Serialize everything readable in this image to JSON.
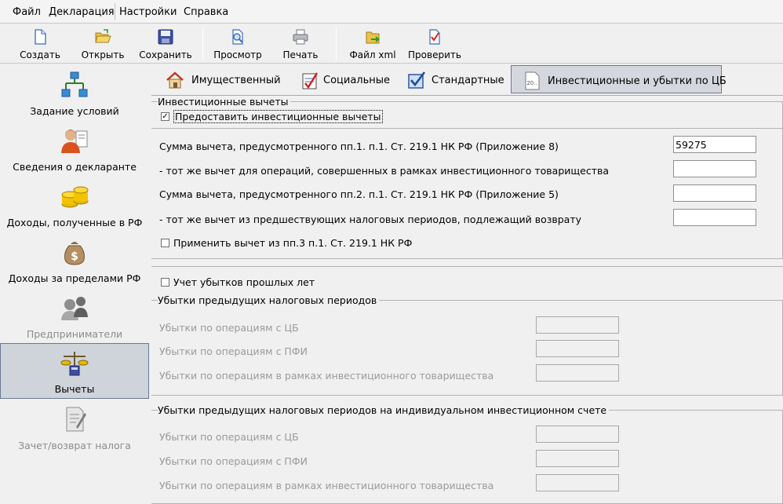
{
  "menu": {
    "items": [
      "Файл",
      "Декларация",
      "Настройки",
      "Справка"
    ]
  },
  "toolbar": {
    "create": "Создать",
    "open": "Открыть",
    "save": "Сохранить",
    "preview": "Просмотр",
    "print": "Печать",
    "xml": "Файл xml",
    "check": "Проверить"
  },
  "sidebar": {
    "items": [
      {
        "label": "Задание условий",
        "icon": "conditions-icon",
        "state": "normal"
      },
      {
        "label": "Сведения о декларанте",
        "icon": "declarant-icon",
        "state": "normal"
      },
      {
        "label": "Доходы, полученные в РФ",
        "icon": "coins-icon",
        "state": "normal"
      },
      {
        "label": "Доходы за пределами РФ",
        "icon": "money-bag-icon",
        "state": "normal"
      },
      {
        "label": "Предприниматели",
        "icon": "entrepreneurs-icon",
        "state": "disabled"
      },
      {
        "label": "Вычеты",
        "icon": "deductions-icon",
        "state": "active"
      },
      {
        "label": "Зачет/возврат налога",
        "icon": "refund-icon",
        "state": "disabled"
      }
    ]
  },
  "tabs": [
    {
      "label": "Имущественный",
      "icon": "house-icon"
    },
    {
      "label": "Социальные",
      "icon": "checklist-icon"
    },
    {
      "label": "Стандартные",
      "icon": "standard-check-icon"
    },
    {
      "label": "Инвестиционные и убытки по ЦБ",
      "icon": "document-icon",
      "active": true
    }
  ],
  "investment": {
    "legend": "Инвестиционные вычеты",
    "provide_label": "Предоставить инвестиционные вычеты",
    "provide_checked": true,
    "rows": [
      {
        "label": "Сумма вычета, предусмотренного пп.1. п.1. Ст. 219.1 НК РФ (Приложение 8)",
        "value": "59275"
      },
      {
        "label": "- тот же вычет для операций, совершенных в рамках инвестиционного товарищества",
        "value": ""
      },
      {
        "label": "Сумма вычета, предусмотренного пп.2. п.1. Ст. 219.1 НК РФ (Приложение 5)",
        "value": ""
      },
      {
        "label": "- тот же вычет из предшествующих налоговых периодов, подлежащий возврату",
        "value": ""
      }
    ],
    "apply_label": "Применить вычет из пп.3 п.1. Ст. 219.1 НК РФ",
    "apply_checked": false
  },
  "losses": {
    "account_label": "Учет убытков прошлых лет",
    "account_checked": false,
    "prev_legend": "Убытки предыдущих налоговых периодов",
    "prev_rows": [
      {
        "label": "Убытки по операциям с ЦБ",
        "value": ""
      },
      {
        "label": "Убытки по операциям с ПФИ",
        "value": ""
      },
      {
        "label": "Убытки по операциям в рамках инвестиционного товарищества",
        "value": ""
      }
    ],
    "iis_legend": "Убытки предыдущих налоговых периодов на индивидуальном инвестиционном счете",
    "iis_rows": [
      {
        "label": "Убытки по операциям с ЦБ",
        "value": ""
      },
      {
        "label": "Убытки по операциям с ПФИ",
        "value": ""
      },
      {
        "label": "Убытки по операциям в рамках инвестиционного товарищества",
        "value": ""
      }
    ]
  }
}
